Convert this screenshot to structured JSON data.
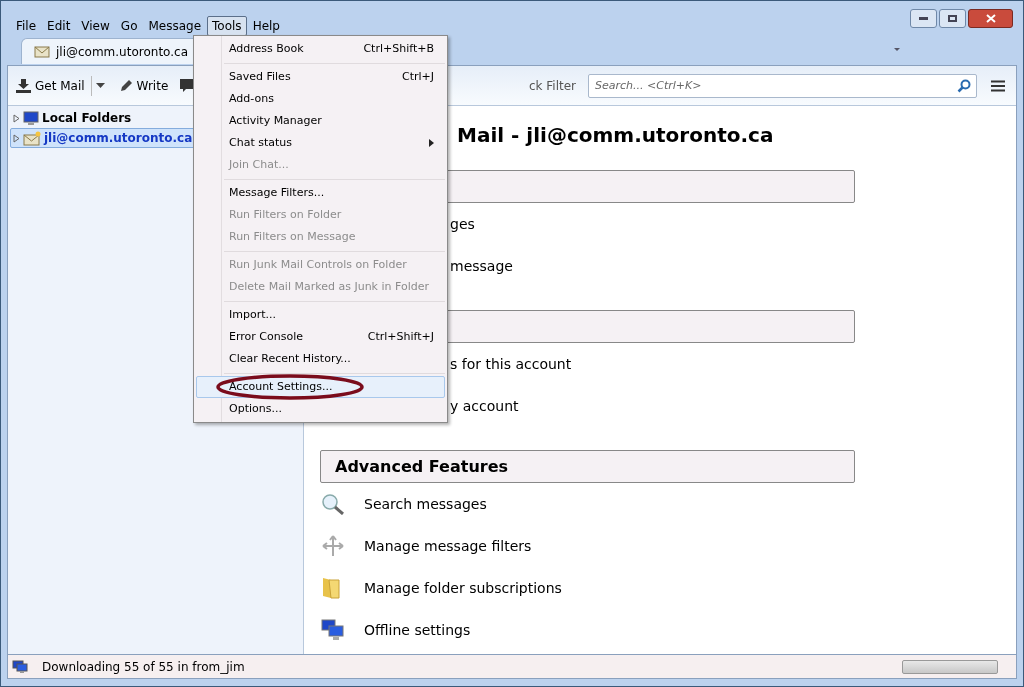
{
  "menu_bar": [
    {
      "label": "File",
      "selected": false
    },
    {
      "label": "Edit",
      "selected": false
    },
    {
      "label": "View",
      "selected": false
    },
    {
      "label": "Go",
      "selected": false
    },
    {
      "label": "Message",
      "selected": false
    },
    {
      "label": "Tools",
      "selected": true
    },
    {
      "label": "Help",
      "selected": false
    }
  ],
  "tab": {
    "title": "jli@comm.utoronto.ca"
  },
  "toolbar": {
    "items": [
      {
        "kind": "get_mail",
        "label": "Get Mail"
      },
      {
        "kind": "write",
        "label": "Write"
      },
      {
        "kind": "chat"
      }
    ],
    "quick_filter": "ck Filter",
    "search": {
      "placeholder": "Search... <Ctrl+K>"
    }
  },
  "folder_tree": [
    {
      "label": "Local Folders",
      "kind": "local",
      "selected": false
    },
    {
      "label": "jli@comm.utoronto.ca",
      "kind": "account",
      "selected": true
    }
  ],
  "content": {
    "title": "Mail - jli@comm.utoronto.ca",
    "sections": [
      {
        "rows": [
          {
            "text": "ges"
          },
          {
            "text": "message"
          }
        ]
      },
      {
        "rows": [
          {
            "text": "s for this account"
          },
          {
            "text": "y account"
          }
        ]
      },
      {
        "heading": "Advanced Features",
        "rows": [
          {
            "kind": "search",
            "text": "Search messages"
          },
          {
            "kind": "filters",
            "text": "Manage message filters"
          },
          {
            "kind": "folder",
            "text": "Manage folder subscriptions"
          },
          {
            "kind": "offline",
            "text": "Offline settings"
          }
        ]
      }
    ]
  },
  "tools_menu": [
    {
      "kind": "item",
      "label": "Address Book",
      "shortcut": "Ctrl+Shift+B",
      "disabled": false,
      "selected": false,
      "circled": false
    },
    {
      "kind": "separator"
    },
    {
      "kind": "item",
      "label": "Saved Files",
      "shortcut": "Ctrl+J",
      "disabled": false,
      "selected": false,
      "circled": false
    },
    {
      "kind": "item",
      "label": "Add-ons",
      "disabled": false,
      "selected": false,
      "circled": false
    },
    {
      "kind": "item",
      "label": "Activity Manager",
      "disabled": false,
      "selected": false,
      "circled": false
    },
    {
      "kind": "submenu",
      "label": "Chat status",
      "disabled": false,
      "selected": false,
      "circled": false
    },
    {
      "kind": "item",
      "label": "Join Chat...",
      "disabled": true,
      "selected": false,
      "circled": false
    },
    {
      "kind": "separator"
    },
    {
      "kind": "item",
      "label": "Message Filters...",
      "disabled": false,
      "selected": false,
      "circled": false
    },
    {
      "kind": "item",
      "label": "Run Filters on Folder",
      "disabled": true,
      "selected": false,
      "circled": false
    },
    {
      "kind": "item",
      "label": "Run Filters on Message",
      "disabled": true,
      "selected": false,
      "circled": false
    },
    {
      "kind": "separator"
    },
    {
      "kind": "item",
      "label": "Run Junk Mail Controls on Folder",
      "disabled": true,
      "selected": false,
      "circled": false
    },
    {
      "kind": "item",
      "label": "Delete Mail Marked as Junk in Folder",
      "disabled": true,
      "selected": false,
      "circled": false
    },
    {
      "kind": "separator"
    },
    {
      "kind": "item",
      "label": "Import...",
      "disabled": false,
      "selected": false,
      "circled": false
    },
    {
      "kind": "item",
      "label": "Error Console",
      "shortcut": "Ctrl+Shift+J",
      "disabled": false,
      "selected": false,
      "circled": false
    },
    {
      "kind": "item",
      "label": "Clear Recent History...",
      "disabled": false,
      "selected": false,
      "circled": false
    },
    {
      "kind": "separator"
    },
    {
      "kind": "item",
      "label": "Account Settings...",
      "disabled": false,
      "selected": true,
      "circled": true
    },
    {
      "kind": "item",
      "label": "Options...",
      "disabled": false,
      "selected": false,
      "circled": false
    }
  ],
  "status_bar": {
    "text": "Downloading 55 of 55 in from_jim",
    "progress": {
      "level": 0
    }
  }
}
